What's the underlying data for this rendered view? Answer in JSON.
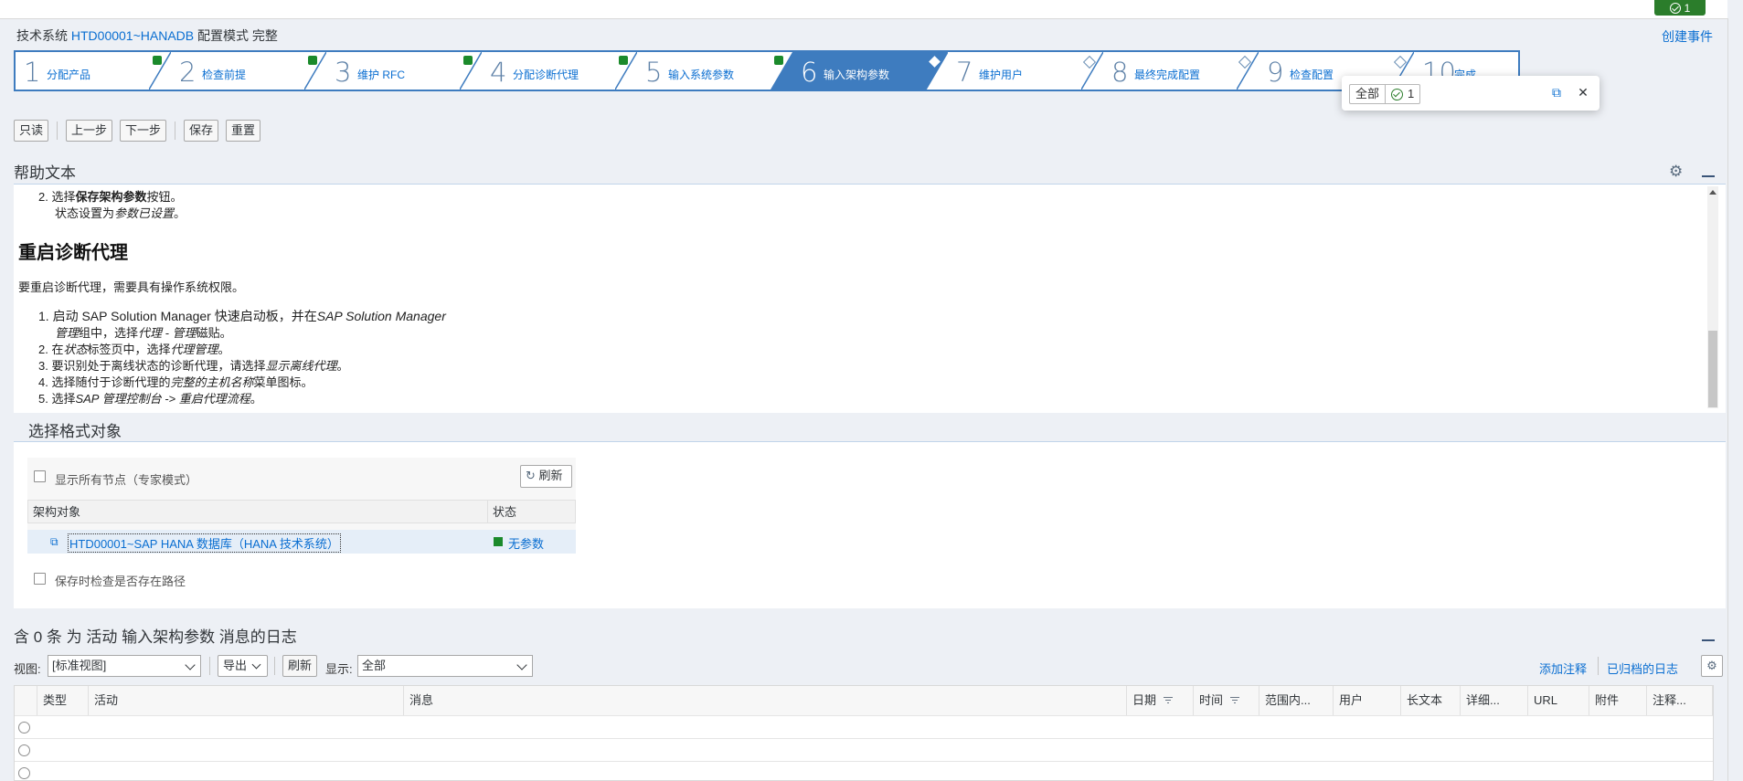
{
  "top": {
    "badge_count": "1",
    "create_event": "创建事件"
  },
  "system": {
    "prefix": "技术系统",
    "name": "HTD00001~HANADB",
    "suffix": "配置模式 完整"
  },
  "roadmap": [
    {
      "num": "1",
      "label": "分配产品",
      "status": "done"
    },
    {
      "num": "2",
      "label": "检查前提",
      "status": "done"
    },
    {
      "num": "3",
      "label": "维护 RFC",
      "status": "done"
    },
    {
      "num": "4",
      "label": "分配诊断代理",
      "status": "done"
    },
    {
      "num": "5",
      "label": "输入系统参数",
      "status": "done"
    },
    {
      "num": "6",
      "label": "输入架构参数",
      "status": "current"
    },
    {
      "num": "7",
      "label": "维护用户",
      "status": "todo"
    },
    {
      "num": "8",
      "label": "最终完成配置",
      "status": "todo"
    },
    {
      "num": "9",
      "label": "检查配置",
      "status": "todo"
    },
    {
      "num": "10",
      "label": "完成",
      "status": "todo"
    }
  ],
  "popover": {
    "all_label": "全部",
    "count": "1"
  },
  "toolbar": {
    "readonly": "只读",
    "prev": "上一步",
    "next": "下一步",
    "save": "保存",
    "reset": "重置"
  },
  "help": {
    "title": "帮助文本",
    "line1_prefix": "2. 选择",
    "line1_bold": "保存架构参数",
    "line1_suffix": "按钮。",
    "line2_prefix": "状态设置为",
    "line2_italic": "参数已设置",
    "line2_suffix": "。",
    "restart_title": "重启诊断代理",
    "restart_intro": "要重启诊断代理，需要具有操作系统权限。",
    "s1a": "1. 启动 SAP Solution Manager 快速启动板，并在",
    "s1a_i": "SAP Solution Manager",
    "s1b_i": "管理",
    "s1b": "组中，选择",
    "s1b_i2": "代理 - 管理",
    "s1b_end": "磁贴。",
    "s2": "2. 在",
    "s2_i": "状态",
    "s2_mid": "标签页中，选择",
    "s2_i2": "代理管理",
    "s2_end": "。",
    "s3": "3. 要识别处于离线状态的诊断代理，请选择",
    "s3_i": "显示离线代理",
    "s3_end": "。",
    "s4": "4. 选择随付于诊断代理的",
    "s4_i": "完整的主机名称",
    "s4_end": "菜单图标。",
    "s5": "5. 选择",
    "s5_i": "SAP 管理控制台 -> 重启代理流程",
    "s5_end": "。"
  },
  "format": {
    "title": "选择格式对象",
    "show_all_nodes": "显示所有节点（专家模式）",
    "refresh": "刷新",
    "col_object": "架构对象",
    "col_status": "状态",
    "row_object": "HTD00001~SAP HANA 数据库（HANA 技术系统）",
    "row_status": "无参数",
    "row_status_color": "#1b8a2b",
    "check_path": "保存时检查是否存在路径"
  },
  "log": {
    "title": "含 0 条 为 活动 输入架构参数 消息的日志",
    "view_label": "视图:",
    "view_value": "[标准视图]",
    "export": "导出",
    "refresh": "刷新",
    "show_label": "显示:",
    "show_value": "全部",
    "add_note": "添加注释",
    "archived_log": "已归档的日志",
    "columns": [
      "类型",
      "活动",
      "消息",
      "日期",
      "时间",
      "范围内...",
      "用户",
      "长文本",
      "详细...",
      "URL",
      "附件",
      "注释..."
    ]
  },
  "colors": {
    "accent": "#0a6ed1",
    "roadmap_active": "#3e7cbf",
    "success": "#1b8a2b"
  }
}
